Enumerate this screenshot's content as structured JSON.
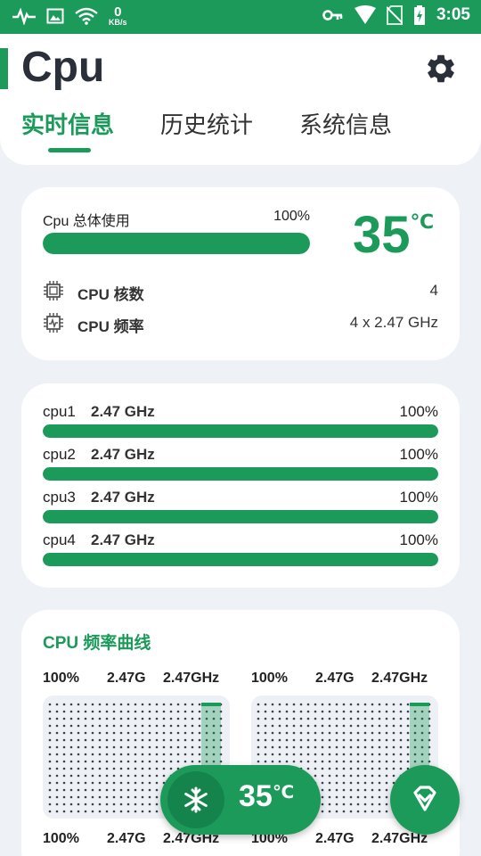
{
  "status_bar": {
    "net_speed_value": "0",
    "net_speed_unit": "KB/s",
    "time": "3:05"
  },
  "header": {
    "title": "Cpu",
    "tabs": [
      {
        "label": "实时信息",
        "active": true
      },
      {
        "label": "历史统计",
        "active": false
      },
      {
        "label": "系统信息",
        "active": false
      }
    ]
  },
  "overview": {
    "usage_label": "Cpu 总体使用",
    "usage_percent_text": "100%",
    "usage_fraction": 1.0,
    "temperature_value": "35",
    "temperature_unit": "℃",
    "core_count_label": "CPU 核数",
    "core_count_value": "4",
    "frequency_label": "CPU 频率",
    "frequency_value": "4 x 2.47 GHz"
  },
  "cores": [
    {
      "name": "cpu1",
      "freq": "2.47 GHz",
      "percent_text": "100%",
      "usage_fraction": 1.0
    },
    {
      "name": "cpu2",
      "freq": "2.47 GHz",
      "percent_text": "100%",
      "usage_fraction": 1.0
    },
    {
      "name": "cpu3",
      "freq": "2.47 GHz",
      "percent_text": "100%",
      "usage_fraction": 1.0
    },
    {
      "name": "cpu4",
      "freq": "2.47 GHz",
      "percent_text": "100%",
      "usage_fraction": 1.0
    }
  ],
  "freq_curve": {
    "title": "CPU 频率曲线",
    "graphs": [
      {
        "usage": "100%",
        "freq": "2.47G",
        "max": "2.47GHz"
      },
      {
        "usage": "100%",
        "freq": "2.47G",
        "max": "2.47GHz"
      },
      {
        "usage": "100%",
        "freq": "2.47G",
        "max": "2.47GHz"
      },
      {
        "usage": "100%",
        "freq": "2.47G",
        "max": "2.47GHz"
      }
    ]
  },
  "float_temp": {
    "value": "35",
    "unit": "℃"
  },
  "icons": {
    "status_left": [
      "activity-icon",
      "image-icon",
      "wifi-icon"
    ],
    "status_right": [
      "key-icon",
      "signal-icon",
      "no-sim-icon",
      "battery-charging-icon"
    ],
    "settings": "gear-icon",
    "cores": "chip-icon",
    "frequency": "chip-pulse-icon",
    "cooling": "snowflake-icon",
    "fab": "diamond-check-icon"
  },
  "colors": {
    "accent": "#1b9a5a",
    "accent_dark": "#14844c",
    "track": "#d8efe2",
    "background": "#eef1f6",
    "card": "#ffffff"
  }
}
